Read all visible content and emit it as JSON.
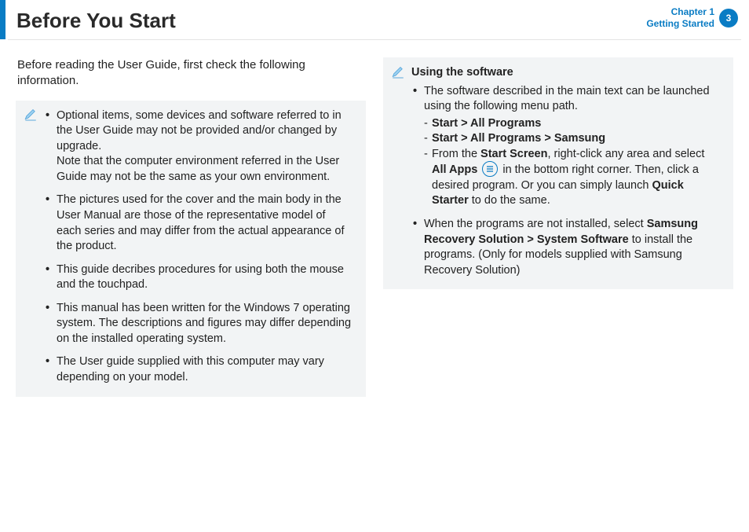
{
  "header": {
    "title": "Before You Start",
    "chapter_line1": "Chapter 1",
    "chapter_line2": "Getting Started",
    "page_number": "3"
  },
  "left": {
    "intro": "Before reading the User Guide, first check the following information.",
    "bullets": {
      "b1a": "Optional items, some devices and software referred to in the User Guide may not be provided and/or changed by upgrade.",
      "b1b": "Note that the computer environment referred in the User Guide may not be the same as your own environment.",
      "b2": "The pictures used for the cover and the main body in the User Manual are those of the representative model of each series and may differ from the actual appearance of the product.",
      "b3": "This guide decribes procedures for using both the mouse and the touchpad.",
      "b4": "This manual has been written for the Windows 7 operating system. The descriptions and figures may differ depending on the installed operating system.",
      "b5": "The User guide supplied with this computer may vary depending on your model."
    }
  },
  "right": {
    "title": "Using the software",
    "b1_intro": "The software described in the main text can be launched using the following menu path.",
    "path1_a": "Start",
    "path1_b": "All Programs",
    "path2_a": "Start",
    "path2_b": "All Programs",
    "path2_c": "Samsung",
    "line3_a": "From the ",
    "line3_b": "Start Screen",
    "line3_c": ", right-click any area and select ",
    "line3_d": "All Apps",
    "line3_e": " in the bottom right corner. Then, click a desired program. Or you can simply launch ",
    "line3_f": "Quick Starter",
    "line3_g": " to do the same.",
    "b2_a": "When the programs are not installed, select ",
    "b2_b": "Samsung Recovery Solution",
    "b2_c": "System Software",
    "b2_d": " to install the programs. (Only for models supplied with Samsung Recovery Solution)",
    "gt": " > "
  }
}
